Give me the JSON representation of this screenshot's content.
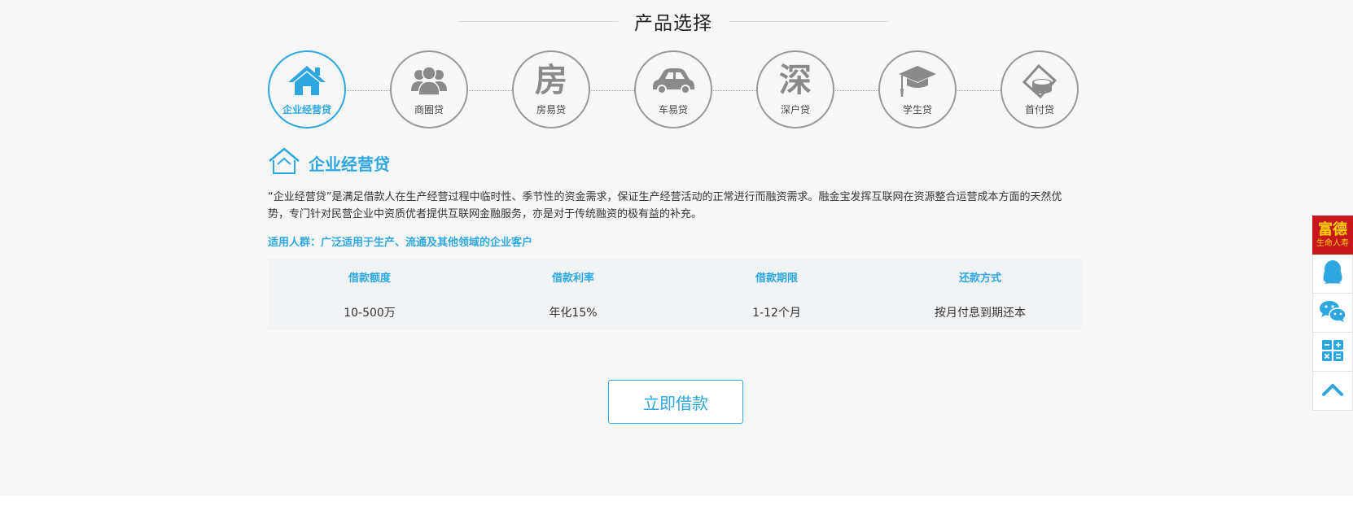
{
  "section": {
    "title": "产品选择"
  },
  "products": [
    {
      "label": "企业经营贷",
      "icon": "house-icon",
      "active": true
    },
    {
      "label": "商圈贷",
      "icon": "group-icon",
      "active": false
    },
    {
      "label": "房易贷",
      "icon": "fang-character-icon",
      "glyph": "房",
      "active": false
    },
    {
      "label": "车易贷",
      "icon": "car-icon",
      "active": false
    },
    {
      "label": "深户贷",
      "icon": "shen-character-icon",
      "glyph": "深",
      "active": false
    },
    {
      "label": "学生贷",
      "icon": "graduation-cap-icon",
      "active": false
    },
    {
      "label": "首付贷",
      "icon": "coins-wallet-icon",
      "active": false
    }
  ],
  "detail": {
    "title": "企业经营贷",
    "description": "“企业经营贷”是满足借款人在生产经营过程中临时性、季节性的资金需求，保证生产经营活动的正常进行而融资需求。融金宝发挥互联网在资源整合运营成本方面的天然优势，专门针对民营企业中资质优者提供互联网金融服务，亦是对于传统融资的极有益的补充。",
    "audience": "适用人群：广泛适用于生产、流通及其他领域的企业客户"
  },
  "table": {
    "headers": [
      "借款额度",
      "借款利率",
      "借款期限",
      "还款方式"
    ],
    "values": [
      "10-500万",
      "年化15%",
      "1-12个月",
      "按月付息到期还本"
    ]
  },
  "apply_button": "立即借款",
  "sidebar": {
    "logo_big": "富德",
    "logo_small": "生命人寿",
    "items": [
      "qq-icon",
      "wechat-icon",
      "calculator-icon",
      "back-to-top-icon"
    ]
  },
  "colors": {
    "accent": "#2ea7e0",
    "inactive": "#999999",
    "background": "#f7f7f7",
    "logo_red": "#c8161d",
    "logo_gold": "#ffd200"
  }
}
